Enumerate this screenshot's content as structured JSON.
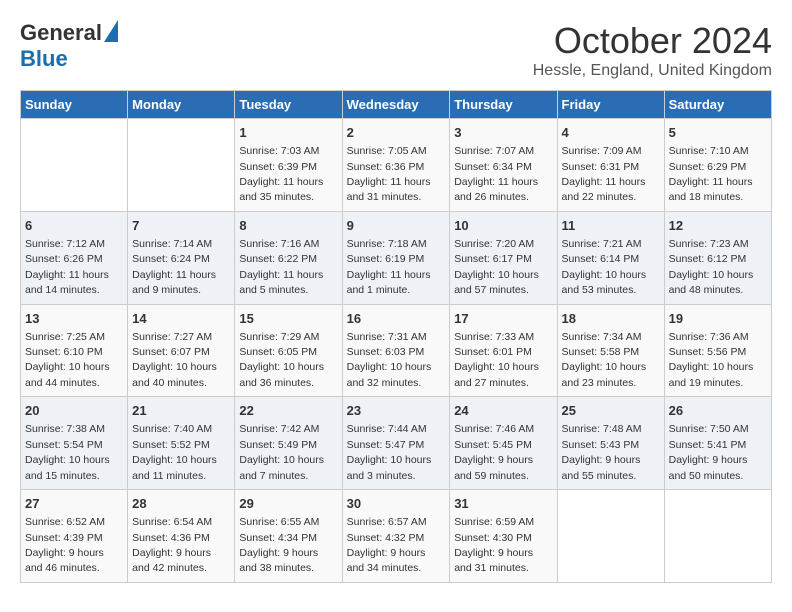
{
  "logo": {
    "general": "General",
    "blue": "Blue"
  },
  "header": {
    "month": "October 2024",
    "location": "Hessle, England, United Kingdom"
  },
  "weekdays": [
    "Sunday",
    "Monday",
    "Tuesday",
    "Wednesday",
    "Thursday",
    "Friday",
    "Saturday"
  ],
  "weeks": [
    [
      {
        "day": "",
        "sunrise": "",
        "sunset": "",
        "daylight": ""
      },
      {
        "day": "",
        "sunrise": "",
        "sunset": "",
        "daylight": ""
      },
      {
        "day": "1",
        "sunrise": "Sunrise: 7:03 AM",
        "sunset": "Sunset: 6:39 PM",
        "daylight": "Daylight: 11 hours and 35 minutes."
      },
      {
        "day": "2",
        "sunrise": "Sunrise: 7:05 AM",
        "sunset": "Sunset: 6:36 PM",
        "daylight": "Daylight: 11 hours and 31 minutes."
      },
      {
        "day": "3",
        "sunrise": "Sunrise: 7:07 AM",
        "sunset": "Sunset: 6:34 PM",
        "daylight": "Daylight: 11 hours and 26 minutes."
      },
      {
        "day": "4",
        "sunrise": "Sunrise: 7:09 AM",
        "sunset": "Sunset: 6:31 PM",
        "daylight": "Daylight: 11 hours and 22 minutes."
      },
      {
        "day": "5",
        "sunrise": "Sunrise: 7:10 AM",
        "sunset": "Sunset: 6:29 PM",
        "daylight": "Daylight: 11 hours and 18 minutes."
      }
    ],
    [
      {
        "day": "6",
        "sunrise": "Sunrise: 7:12 AM",
        "sunset": "Sunset: 6:26 PM",
        "daylight": "Daylight: 11 hours and 14 minutes."
      },
      {
        "day": "7",
        "sunrise": "Sunrise: 7:14 AM",
        "sunset": "Sunset: 6:24 PM",
        "daylight": "Daylight: 11 hours and 9 minutes."
      },
      {
        "day": "8",
        "sunrise": "Sunrise: 7:16 AM",
        "sunset": "Sunset: 6:22 PM",
        "daylight": "Daylight: 11 hours and 5 minutes."
      },
      {
        "day": "9",
        "sunrise": "Sunrise: 7:18 AM",
        "sunset": "Sunset: 6:19 PM",
        "daylight": "Daylight: 11 hours and 1 minute."
      },
      {
        "day": "10",
        "sunrise": "Sunrise: 7:20 AM",
        "sunset": "Sunset: 6:17 PM",
        "daylight": "Daylight: 10 hours and 57 minutes."
      },
      {
        "day": "11",
        "sunrise": "Sunrise: 7:21 AM",
        "sunset": "Sunset: 6:14 PM",
        "daylight": "Daylight: 10 hours and 53 minutes."
      },
      {
        "day": "12",
        "sunrise": "Sunrise: 7:23 AM",
        "sunset": "Sunset: 6:12 PM",
        "daylight": "Daylight: 10 hours and 48 minutes."
      }
    ],
    [
      {
        "day": "13",
        "sunrise": "Sunrise: 7:25 AM",
        "sunset": "Sunset: 6:10 PM",
        "daylight": "Daylight: 10 hours and 44 minutes."
      },
      {
        "day": "14",
        "sunrise": "Sunrise: 7:27 AM",
        "sunset": "Sunset: 6:07 PM",
        "daylight": "Daylight: 10 hours and 40 minutes."
      },
      {
        "day": "15",
        "sunrise": "Sunrise: 7:29 AM",
        "sunset": "Sunset: 6:05 PM",
        "daylight": "Daylight: 10 hours and 36 minutes."
      },
      {
        "day": "16",
        "sunrise": "Sunrise: 7:31 AM",
        "sunset": "Sunset: 6:03 PM",
        "daylight": "Daylight: 10 hours and 32 minutes."
      },
      {
        "day": "17",
        "sunrise": "Sunrise: 7:33 AM",
        "sunset": "Sunset: 6:01 PM",
        "daylight": "Daylight: 10 hours and 27 minutes."
      },
      {
        "day": "18",
        "sunrise": "Sunrise: 7:34 AM",
        "sunset": "Sunset: 5:58 PM",
        "daylight": "Daylight: 10 hours and 23 minutes."
      },
      {
        "day": "19",
        "sunrise": "Sunrise: 7:36 AM",
        "sunset": "Sunset: 5:56 PM",
        "daylight": "Daylight: 10 hours and 19 minutes."
      }
    ],
    [
      {
        "day": "20",
        "sunrise": "Sunrise: 7:38 AM",
        "sunset": "Sunset: 5:54 PM",
        "daylight": "Daylight: 10 hours and 15 minutes."
      },
      {
        "day": "21",
        "sunrise": "Sunrise: 7:40 AM",
        "sunset": "Sunset: 5:52 PM",
        "daylight": "Daylight: 10 hours and 11 minutes."
      },
      {
        "day": "22",
        "sunrise": "Sunrise: 7:42 AM",
        "sunset": "Sunset: 5:49 PM",
        "daylight": "Daylight: 10 hours and 7 minutes."
      },
      {
        "day": "23",
        "sunrise": "Sunrise: 7:44 AM",
        "sunset": "Sunset: 5:47 PM",
        "daylight": "Daylight: 10 hours and 3 minutes."
      },
      {
        "day": "24",
        "sunrise": "Sunrise: 7:46 AM",
        "sunset": "Sunset: 5:45 PM",
        "daylight": "Daylight: 9 hours and 59 minutes."
      },
      {
        "day": "25",
        "sunrise": "Sunrise: 7:48 AM",
        "sunset": "Sunset: 5:43 PM",
        "daylight": "Daylight: 9 hours and 55 minutes."
      },
      {
        "day": "26",
        "sunrise": "Sunrise: 7:50 AM",
        "sunset": "Sunset: 5:41 PM",
        "daylight": "Daylight: 9 hours and 50 minutes."
      }
    ],
    [
      {
        "day": "27",
        "sunrise": "Sunrise: 6:52 AM",
        "sunset": "Sunset: 4:39 PM",
        "daylight": "Daylight: 9 hours and 46 minutes."
      },
      {
        "day": "28",
        "sunrise": "Sunrise: 6:54 AM",
        "sunset": "Sunset: 4:36 PM",
        "daylight": "Daylight: 9 hours and 42 minutes."
      },
      {
        "day": "29",
        "sunrise": "Sunrise: 6:55 AM",
        "sunset": "Sunset: 4:34 PM",
        "daylight": "Daylight: 9 hours and 38 minutes."
      },
      {
        "day": "30",
        "sunrise": "Sunrise: 6:57 AM",
        "sunset": "Sunset: 4:32 PM",
        "daylight": "Daylight: 9 hours and 34 minutes."
      },
      {
        "day": "31",
        "sunrise": "Sunrise: 6:59 AM",
        "sunset": "Sunset: 4:30 PM",
        "daylight": "Daylight: 9 hours and 31 minutes."
      },
      {
        "day": "",
        "sunrise": "",
        "sunset": "",
        "daylight": ""
      },
      {
        "day": "",
        "sunrise": "",
        "sunset": "",
        "daylight": ""
      }
    ]
  ]
}
